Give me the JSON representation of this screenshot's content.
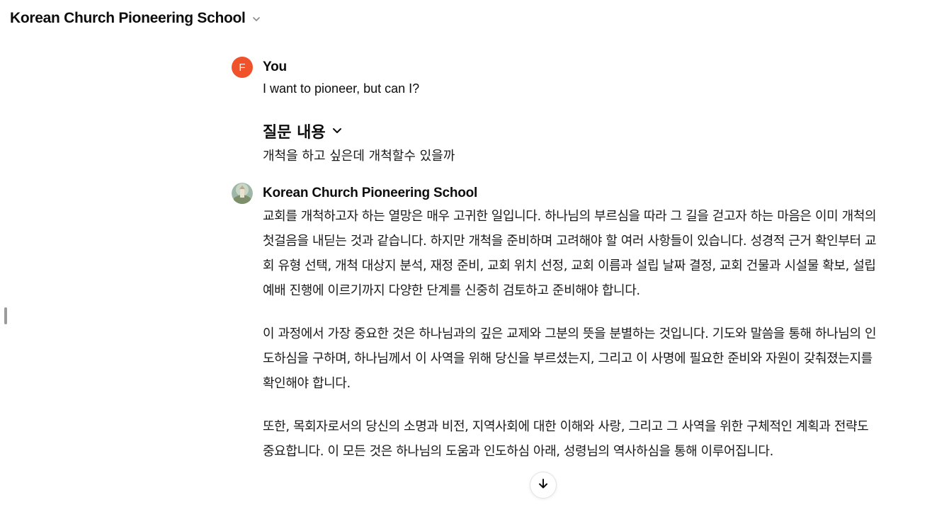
{
  "header": {
    "title": "Korean Church Pioneering School",
    "dropdown_icon": "chevron-down-icon"
  },
  "user_message": {
    "avatar_letter": "F",
    "avatar_color": "#f0532b",
    "sender": "You",
    "text": "I want to pioneer, but can I?"
  },
  "question": {
    "title": "질문 내용",
    "toggle_icon": "chevron-down-icon",
    "text": "개척을 하고 싶은데 개척할수 있을까"
  },
  "bot_message": {
    "sender": "Korean Church Pioneering School",
    "avatar_icon": "gpt-avatar-image",
    "paragraphs": [
      "교회를 개척하고자 하는 열망은 매우 고귀한 일입니다. 하나님의 부르심을 따라 그 길을 걷고자 하는 마음은 이미 개척의 첫걸음을 내딛는 것과 같습니다. 하지만 개척을 준비하며 고려해야 할 여러 사항들이 있습니다. 성경적 근거 확인부터 교회 유형 선택, 개척 대상지 분석, 재정 준비, 교회 위치 선정, 교회 이름과 설립 날짜 결정, 교회 건물과 시설물 확보, 설립 예배 진행에 이르기까지 다양한 단계를 신중히 검토하고 준비해야 합니다.",
      "이 과정에서 가장 중요한 것은 하나님과의 깊은 교제와 그분의 뜻을 분별하는 것입니다. 기도와 말씀을 통해 하나님의 인도하심을 구하며, 하나님께서 이 사역을 위해 당신을 부르셨는지, 그리고 이 사명에 필요한 준비와 자원이 갖춰졌는지를 확인해야 합니다.",
      "또한, 목회자로서의 당신의 소명과 비전, 지역사회에 대한 이해와 사랑, 그리고 그 사역을 위한 구체적인 계획과 전략도 중요합니다. 이 모든 것은 하나님의 도움과 인도하심 아래, 성령님의 역사하심을 통해 이루어집니다."
    ]
  },
  "scroll_button": {
    "icon": "arrow-down-icon"
  }
}
